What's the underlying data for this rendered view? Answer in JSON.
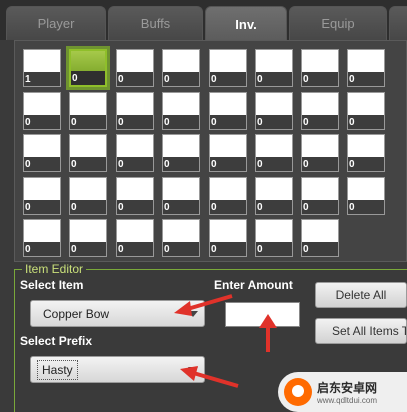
{
  "tabs": [
    {
      "label": "Player",
      "active": false
    },
    {
      "label": "Buffs",
      "active": false
    },
    {
      "label": "Inv.",
      "active": true
    },
    {
      "label": "Equip",
      "active": false
    }
  ],
  "inventory": {
    "selected_slot": 1,
    "rows": [
      [
        "1",
        "0",
        "0",
        "0",
        "0",
        "0",
        "0",
        "0"
      ],
      [
        "0",
        "0",
        "0",
        "0",
        "0",
        "0",
        "0",
        "0"
      ],
      [
        "0",
        "0",
        "0",
        "0",
        "0",
        "0",
        "0",
        "0"
      ],
      [
        "0",
        "0",
        "0",
        "0",
        "0",
        "0",
        "0",
        "0"
      ],
      [
        "0",
        "0",
        "0",
        "0",
        "0",
        "0",
        "0"
      ]
    ]
  },
  "editor": {
    "title": "Item Editor",
    "select_item_label": "Select Item",
    "selected_item": "Copper Bow",
    "enter_amount_label": "Enter Amount",
    "amount_value": "",
    "select_prefix_label": "Select Prefix",
    "selected_prefix": "Hasty",
    "delete_all_label": "Delete All",
    "set_all_items_label": "Set All Items T"
  },
  "watermark": {
    "name": "启东安卓网",
    "url": "www.qdltdui.com"
  },
  "colors": {
    "selected_slot": "#8fbf2a",
    "annotation_arrow": "#e0322a",
    "editor_title": "#c9e07a"
  }
}
